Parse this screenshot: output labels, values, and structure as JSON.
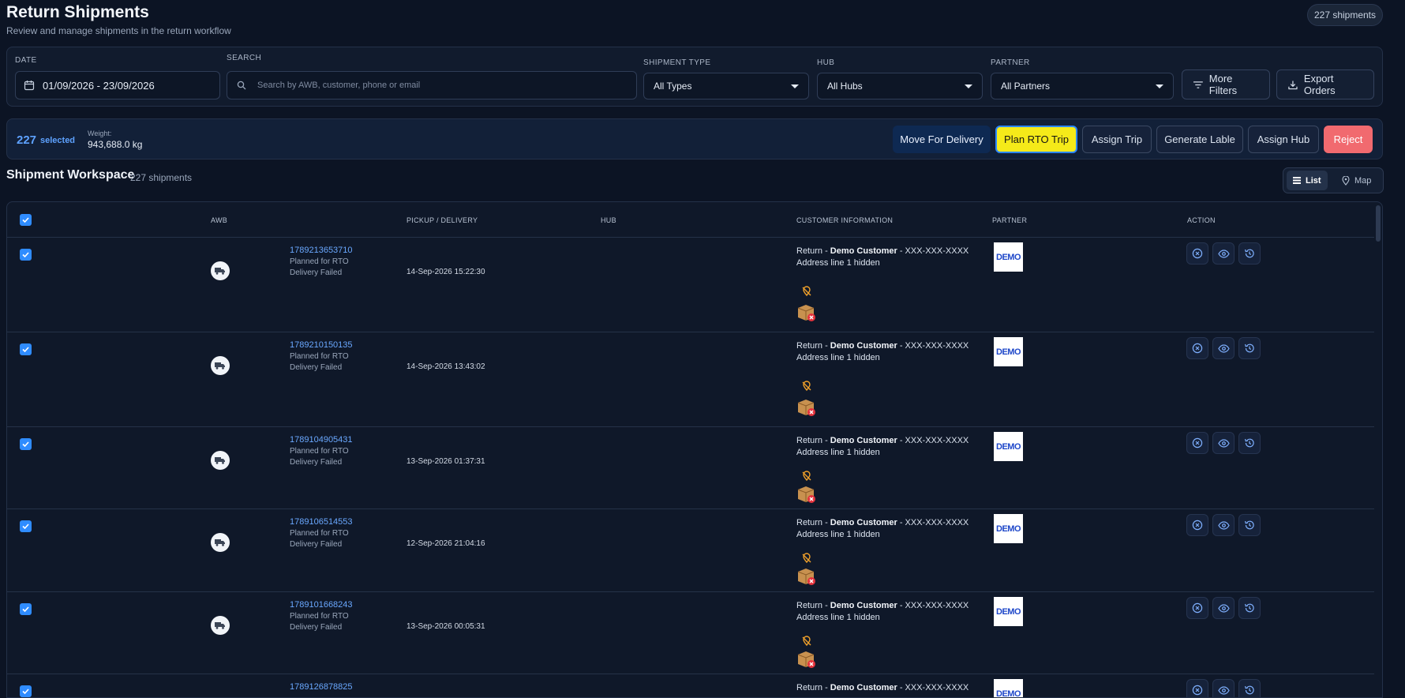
{
  "header": {
    "title": "Return Shipments",
    "subtitle": "Review and manage shipments in the return workflow",
    "count_badge": "227 shipments"
  },
  "filters": {
    "date_label": "DATE",
    "date_value": "01/09/2026 - 23/09/2026",
    "search_label": "SEARCH",
    "search_placeholder": "Search by AWB, customer, phone or email",
    "shipment_type_label": "SHIPMENT TYPE",
    "shipment_type_value": "All Types",
    "hub_label": "HUB",
    "hub_value": "All Hubs",
    "partner_label": "PARTNER",
    "partner_value": "All Partners",
    "more_filters": "More Filters",
    "export_orders": "Export Orders"
  },
  "selection": {
    "count": "227",
    "selected_word": "selected",
    "weight_label": "Weight:",
    "weight_value": "943,688.0 kg",
    "actions": {
      "move_for_delivery": "Move For Delivery",
      "plan_rto_trip": "Plan RTO Trip",
      "assign_trip": "Assign Trip",
      "generate_lable": "Generate Lable",
      "assign_hub": "Assign Hub",
      "reject": "Reject"
    }
  },
  "workspace": {
    "title": "Shipment Workspace",
    "count": "227 shipments",
    "view_list": "List",
    "view_map": "Map"
  },
  "table": {
    "columns": {
      "awb": "AWB",
      "pickup_delivery": "PICKUP / DELIVERY",
      "hub": "HUB",
      "customer": "CUSTOMER INFORMATION",
      "partner": "PARTNER",
      "action": "ACTION"
    },
    "rows": [
      {
        "awb": "1789213653710",
        "status1": "Planned for RTO",
        "status2": "Delivery Failed",
        "datetime": "14-Sep-2026 15:22:30",
        "cust_prefix": "Return - ",
        "cust_name": "Demo Customer",
        "cust_phone": " - XXX-XXX-XXXX",
        "address": "Address line 1 hidden",
        "partner_logo": "DEMO"
      },
      {
        "awb": "1789210150135",
        "status1": "Planned for RTO",
        "status2": "Delivery Failed",
        "datetime": "14-Sep-2026 13:43:02",
        "cust_prefix": "Return - ",
        "cust_name": "Demo Customer",
        "cust_phone": " - XXX-XXX-XXXX",
        "address": "Address line 1 hidden",
        "partner_logo": "DEMO"
      },
      {
        "awb": "1789104905431",
        "status1": "Planned for RTO",
        "status2": "Delivery Failed",
        "datetime": "13-Sep-2026 01:37:31",
        "cust_prefix": "Return - ",
        "cust_name": "Demo Customer",
        "cust_phone": " - XXX-XXX-XXXX",
        "address": "Address line 1 hidden",
        "partner_logo": "DEMO"
      },
      {
        "awb": "1789106514553",
        "status1": "Planned for RTO",
        "status2": "Delivery Failed",
        "datetime": "12-Sep-2026 21:04:16",
        "cust_prefix": "Return - ",
        "cust_name": "Demo Customer",
        "cust_phone": " - XXX-XXX-XXXX",
        "address": "Address line 1 hidden",
        "partner_logo": "DEMO"
      },
      {
        "awb": "1789101668243",
        "status1": "Planned for RTO",
        "status2": "Delivery Failed",
        "datetime": "13-Sep-2026 00:05:31",
        "cust_prefix": "Return - ",
        "cust_name": "Demo Customer",
        "cust_phone": " - XXX-XXX-XXXX",
        "address": "Address line 1 hidden",
        "partner_logo": "DEMO"
      },
      {
        "awb": "1789126878825",
        "cust_prefix": "Return - ",
        "cust_name": "Demo Customer",
        "cust_phone": " - XXX-XXX-XXXX",
        "partner_logo": "DEMO"
      }
    ]
  },
  "icons": {
    "calendar": "calendar-icon",
    "search": "search-icon",
    "filter": "filter-icon",
    "download": "download-icon",
    "list": "list-icon",
    "map_pin": "map-pin-icon",
    "truck": "truck-icon",
    "no_location": "no-location-icon",
    "package_failed": "package-failed-icon",
    "cancel": "cancel-icon",
    "view": "eye-icon",
    "history": "history-icon"
  },
  "colors": {
    "accent": "#2f8cff",
    "highlight": "#f5ea19",
    "danger": "#f16a6f",
    "primary": "#0e2952",
    "link": "#6aa8ff"
  }
}
